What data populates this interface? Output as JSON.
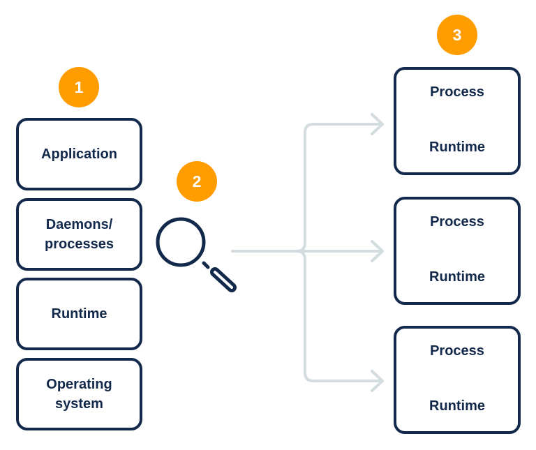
{
  "badges": [
    "1",
    "2",
    "3"
  ],
  "stack": {
    "items": [
      "Application",
      "Daemons/\nprocesses",
      "Runtime",
      "Operating\nsystem"
    ]
  },
  "scan": {
    "icon": "magnifier-icon"
  },
  "targets": [
    {
      "top": "Process",
      "bottom": "Runtime"
    },
    {
      "top": "Process",
      "bottom": "Runtime"
    },
    {
      "top": "Process",
      "bottom": "Runtime"
    }
  ],
  "colors": {
    "accent": "#FF9C00",
    "navy": "#13294B",
    "connector": "#D3DCDF"
  }
}
